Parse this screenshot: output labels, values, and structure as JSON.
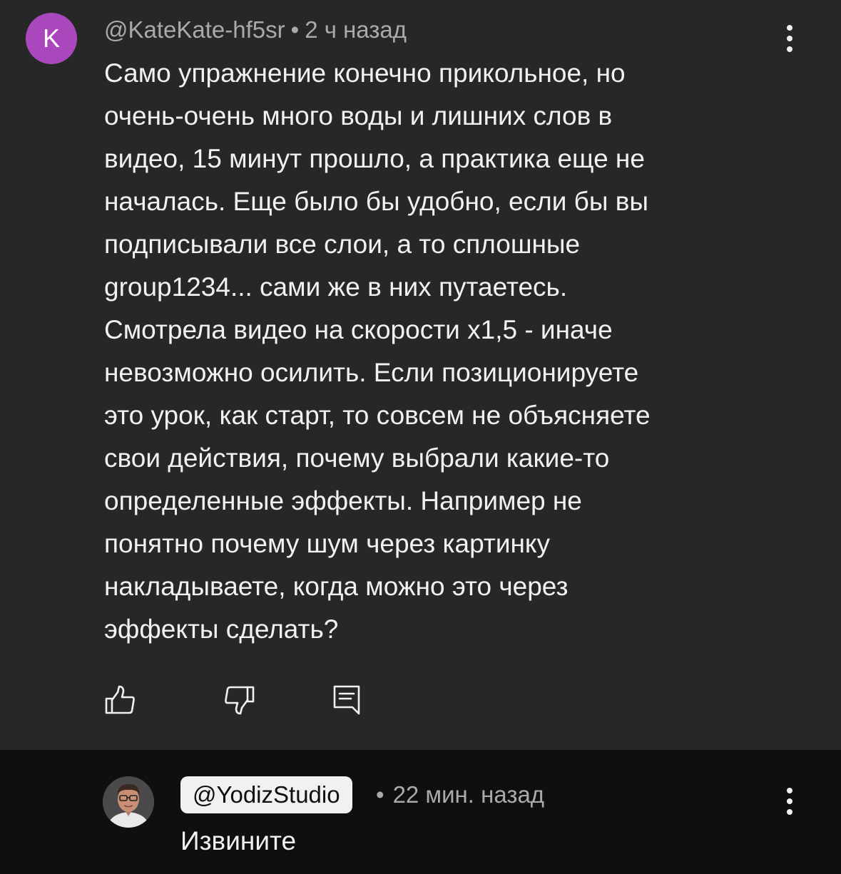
{
  "comment": {
    "avatar_letter": "K",
    "avatar_color": "#ab47bc",
    "author": "@KateKate-hf5sr",
    "separator": "•",
    "time": "2 ч назад",
    "text": "Само упражнение конечно прикольное, но\nочень-очень много воды и лишних слов в\nвидео, 15 минут прошло, а практика еще не\nначалась. Еще было бы удобно, если бы вы\nподписывали все слои, а то сплошные\ngroup1234... сами же в них путаетесь.\nСмотрела видео на скорости x1,5 - иначе\nневозможно осилить. Если позиционируете\nэто урок, как старт, то совсем не объясняете\nсвои действия, почему выбрали какие-то\nопределенные эффекты. Например не\nпонятно почему шум через картинку\nнакладываете, когда можно это через\nэффекты сделать?",
    "actions": {
      "like_icon": "thumbs-up-icon",
      "dislike_icon": "thumbs-down-icon",
      "reply_icon": "reply-icon"
    },
    "menu_icon": "more-vertical-icon"
  },
  "reply": {
    "avatar_icon": "channel-avatar-photo",
    "author": "@YodizStudio",
    "separator": "•",
    "time": "22 мин. назад",
    "text": "Извините",
    "menu_icon": "more-vertical-icon"
  },
  "colors": {
    "comment_bg": "#272727",
    "reply_bg": "#0f0f0f",
    "text": "#f1f1f1",
    "meta": "#aaaaaa",
    "author_chip_bg": "#f1f1f1"
  }
}
